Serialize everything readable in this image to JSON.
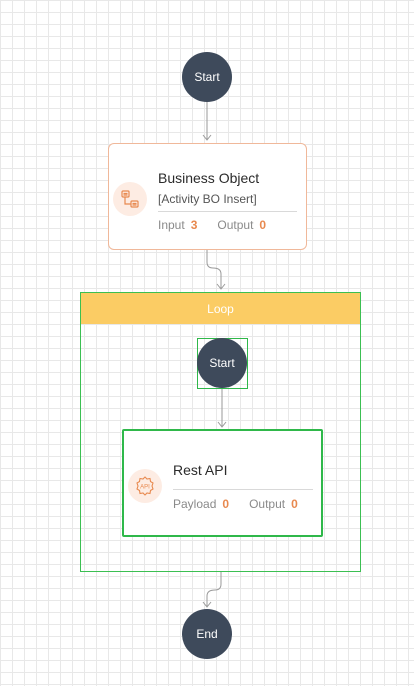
{
  "flow": {
    "start_label": "Start",
    "end_label": "End",
    "business_object": {
      "title": "Business Object",
      "subtitle": "[Activity BO Insert]",
      "input_label": "Input",
      "input_count": "3",
      "output_label": "Output",
      "output_count": "0"
    },
    "loop": {
      "label": "Loop",
      "start_label": "Start",
      "rest_api": {
        "title": "Rest API",
        "icon_text": "API",
        "payload_label": "Payload",
        "payload_count": "0",
        "output_label": "Output",
        "output_count": "0"
      }
    }
  },
  "colors": {
    "node_dark": "#3e4a5b",
    "accent_orange": "#e8894f",
    "loop_header": "#fbcc64",
    "selection_green": "#2fb84a"
  }
}
